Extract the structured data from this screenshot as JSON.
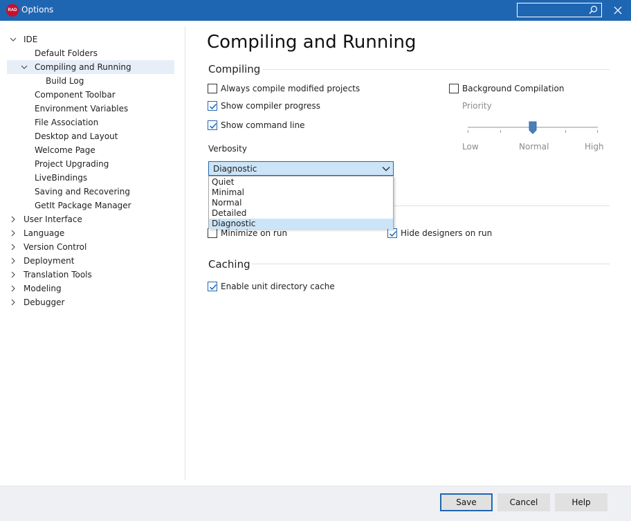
{
  "window": {
    "title": "Options",
    "logo_text": "RAD",
    "search_placeholder": ""
  },
  "sidebar": {
    "items": [
      {
        "label": "IDE",
        "expanded": true
      },
      {
        "label": "Default Folders"
      },
      {
        "label": "Compiling and Running",
        "expanded": true,
        "selected": true
      },
      {
        "label": "Build Log"
      },
      {
        "label": "Component Toolbar"
      },
      {
        "label": "Environment Variables"
      },
      {
        "label": "File Association"
      },
      {
        "label": "Desktop and Layout"
      },
      {
        "label": "Welcome Page"
      },
      {
        "label": "Project Upgrading"
      },
      {
        "label": "LiveBindings"
      },
      {
        "label": "Saving and Recovering"
      },
      {
        "label": "GetIt Package Manager"
      },
      {
        "label": "User Interface",
        "expanded": false
      },
      {
        "label": "Language",
        "expanded": false
      },
      {
        "label": "Version Control",
        "expanded": false
      },
      {
        "label": "Deployment",
        "expanded": false
      },
      {
        "label": "Translation Tools",
        "expanded": false
      },
      {
        "label": "Modeling",
        "expanded": false
      },
      {
        "label": "Debugger",
        "expanded": false
      }
    ]
  },
  "main": {
    "page_title": "Compiling and Running",
    "compiling": {
      "title": "Compiling",
      "always_compile": {
        "label": "Always compile modified projects",
        "checked": false
      },
      "show_progress": {
        "label": "Show compiler progress",
        "checked": true
      },
      "show_command_line": {
        "label": "Show command line",
        "checked": true
      },
      "background_compilation": {
        "label": "Background Compilation",
        "checked": false
      },
      "priority": {
        "label": "Priority",
        "low": "Low",
        "normal": "Normal",
        "high": "High",
        "value": "Normal"
      },
      "verbosity": {
        "label": "Verbosity",
        "value": "Diagnostic",
        "options": [
          "Quiet",
          "Minimal",
          "Normal",
          "Detailed",
          "Diagnostic"
        ]
      }
    },
    "running": {
      "minimize_on_run": {
        "label": "Minimize on run",
        "checked": false
      },
      "hide_designers": {
        "label": "Hide designers on run",
        "checked": true
      }
    },
    "caching": {
      "title": "Caching",
      "enable_cache": {
        "label": "Enable unit directory cache",
        "checked": true
      }
    }
  },
  "buttons": {
    "save": "Save",
    "cancel": "Cancel",
    "help": "Help"
  },
  "colors": {
    "accent": "#1f66b2",
    "selection": "#cce4f7",
    "tree_selection": "#e7eef8"
  }
}
